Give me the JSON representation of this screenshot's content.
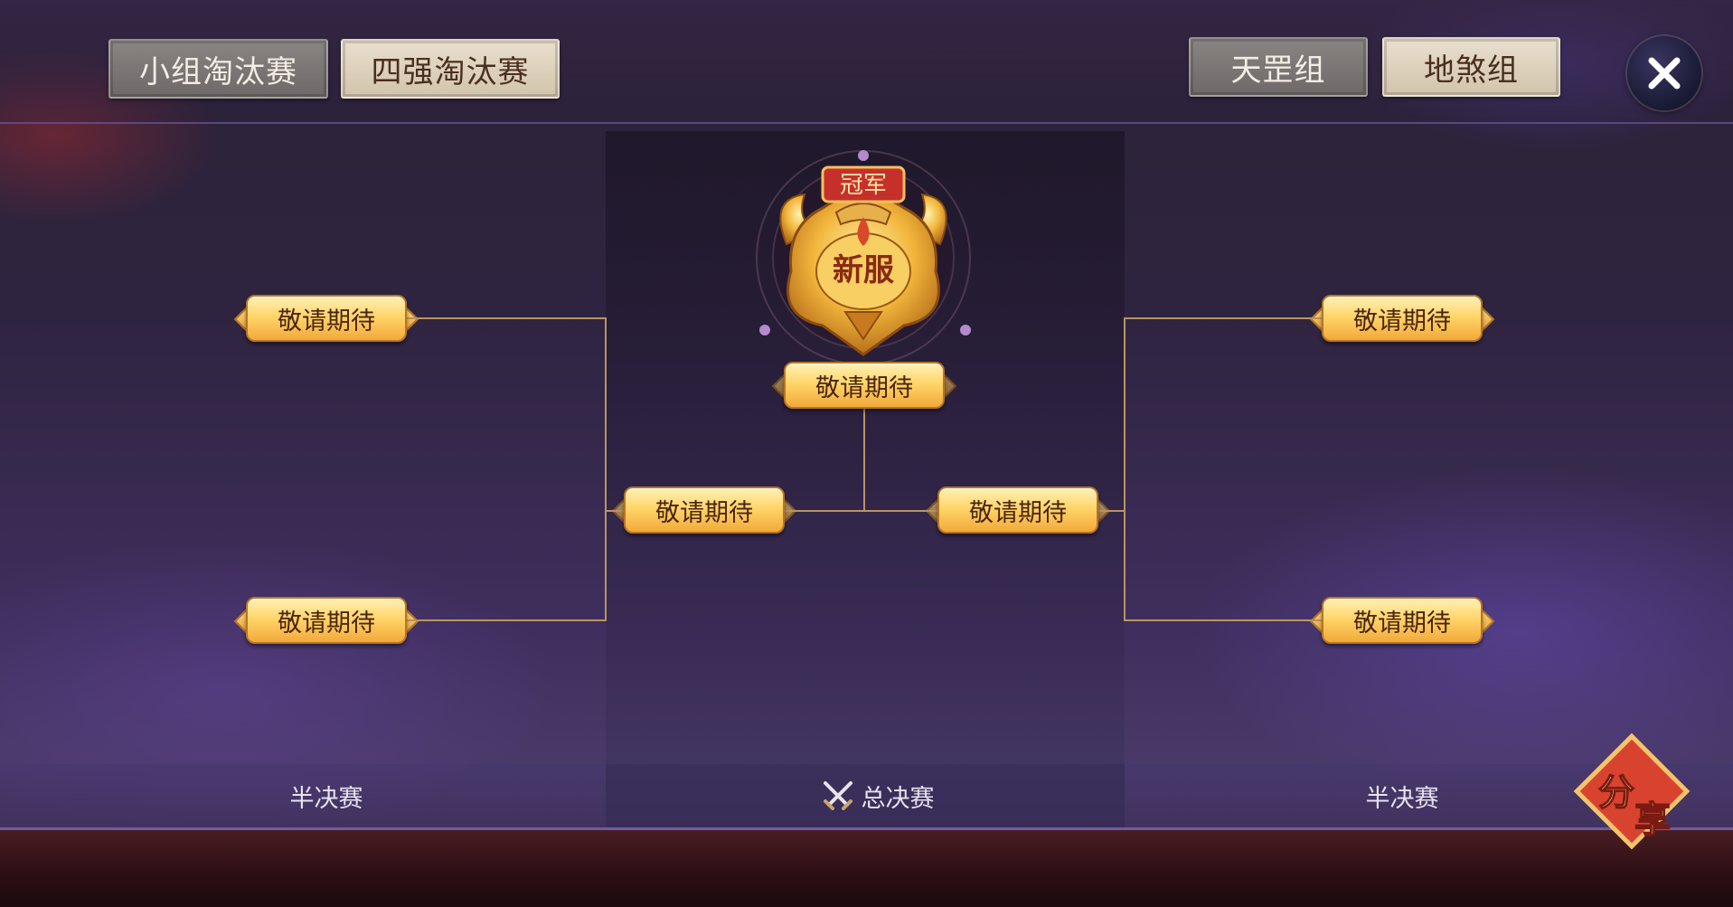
{
  "tabs": {
    "group_elimination": "小组淘汰赛",
    "top4_elimination": "四强淘汰赛",
    "group_tian": "天罡组",
    "group_di": "地煞组"
  },
  "trophy": {
    "top_label": "冠军",
    "center_label": "新服"
  },
  "bracket": {
    "left_top": "敬请期待",
    "left_bottom": "敬请期待",
    "left_final": "敬请期待",
    "champion": "敬请期待",
    "right_final": "敬请期待",
    "right_top": "敬请期待",
    "right_bottom": "敬请期待"
  },
  "rounds": {
    "left": "半决赛",
    "center": "总决赛",
    "right": "半决赛"
  },
  "share": {
    "label_1": "分",
    "label_2": "享"
  },
  "icons": {
    "close": "close-icon",
    "swords": "crossed-swords-icon",
    "trophy": "champion-emblem-icon",
    "share": "share-icon"
  },
  "colors": {
    "plaque_gold": "#ffd66a",
    "bracket_line": "#b99463",
    "share_red": "#d8432f"
  }
}
